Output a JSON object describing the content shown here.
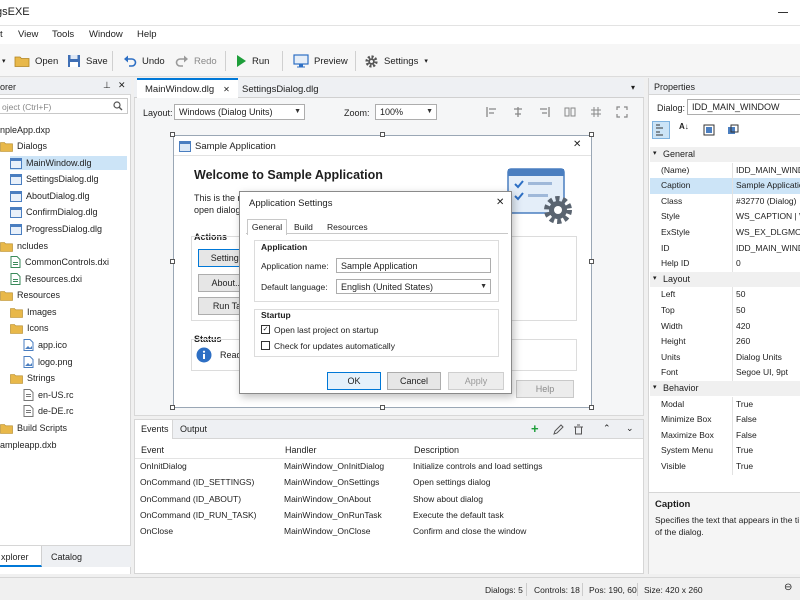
{
  "app": {
    "title": "gsEXE"
  },
  "menu": [
    "t",
    "View",
    "Tools",
    "Window",
    "Help"
  ],
  "toolbar": {
    "open": "Open",
    "save": "Save",
    "undo": "Undo",
    "redo": "Redo",
    "run": "Run",
    "preview": "Preview",
    "settings": "Settings"
  },
  "explorer": {
    "title": "orer",
    "search_placeholder": "oject (Ctrl+F)",
    "items": [
      {
        "label": "npleApp.dxp",
        "icon": "project-icon"
      },
      {
        "label": "Dialogs",
        "icon": "folder-icon"
      },
      {
        "label": "MainWindow.dlg",
        "icon": "dialog-file-icon"
      },
      {
        "label": "SettingsDialog.dlg",
        "icon": "dialog-file-icon"
      },
      {
        "label": "AboutDialog.dlg",
        "icon": "dialog-file-icon"
      },
      {
        "label": "ConfirmDialog.dlg",
        "icon": "dialog-file-icon"
      },
      {
        "label": "ProgressDialog.dlg",
        "icon": "dialog-file-icon"
      },
      {
        "label": "ncludes",
        "icon": "folder-icon"
      },
      {
        "label": "CommonControls.dxi",
        "icon": "include-file-icon"
      },
      {
        "label": "Resources.dxi",
        "icon": "include-file-icon"
      },
      {
        "label": "Resources",
        "icon": "folder-icon"
      },
      {
        "label": "Images",
        "icon": "folder-icon"
      },
      {
        "label": "Icons",
        "icon": "folder-icon"
      },
      {
        "label": "app.ico",
        "icon": "image-file-icon"
      },
      {
        "label": "logo.png",
        "icon": "image-file-icon"
      },
      {
        "label": "Strings",
        "icon": "folder-icon"
      },
      {
        "label": "en-US.rc",
        "icon": "resource-file-icon"
      },
      {
        "label": "de-DE.rc",
        "icon": "resource-file-icon"
      },
      {
        "label": "Build Scripts",
        "icon": "folder-icon"
      },
      {
        "label": "ampleapp.dxb",
        "icon": "build-file-icon"
      }
    ],
    "tabs": [
      "xplorer",
      "Catalog"
    ]
  },
  "editor": {
    "tabs": [
      "MainWindow.dlg",
      "SettingsDialog.dlg"
    ],
    "layout_label": "Layout:",
    "layout_value": "Windows (Dialog Units)",
    "zoom_label": "Zoom:",
    "zoom_value": "100%"
  },
  "sample_dialog": {
    "title": "Sample Application",
    "welcome": "Welcome to Sample Application",
    "intro_line1": "This is the m",
    "intro_line2": "open dialogs",
    "actions_label": "Actions",
    "buttons": [
      "Settings",
      "About...",
      "Run Ta"
    ],
    "status_label": "Status",
    "status_text": "Read",
    "help_button": "Help"
  },
  "settings_dialog": {
    "title": "Application Settings",
    "tabs": [
      "General",
      "Build",
      "Resources"
    ],
    "application_group": "Application",
    "app_name_label": "Application name:",
    "app_name_value": "Sample Application",
    "language_label": "Default language:",
    "language_value": "English (United States)",
    "startup_group": "Startup",
    "check1": "Open last project on startup",
    "check2": "Check for updates automatically",
    "ok": "OK",
    "cancel": "Cancel",
    "apply": "Apply"
  },
  "events_panel": {
    "tabs": [
      "Events",
      "Output"
    ],
    "headers": [
      "Event",
      "Handler",
      "Description"
    ],
    "rows": [
      [
        "OnInitDialog",
        "MainWindow_OnInitDialog",
        "Initialize controls and load settings"
      ],
      [
        "OnCommand (ID_SETTINGS)",
        "MainWindow_OnSettings",
        "Open settings dialog"
      ],
      [
        "OnCommand (ID_ABOUT)",
        "MainWindow_OnAbout",
        "Show about dialog"
      ],
      [
        "OnCommand (ID_RUN_TASK)",
        "MainWindow_OnRunTask",
        "Execute the default task"
      ],
      [
        "OnClose",
        "MainWindow_OnClose",
        "Confirm and close the window"
      ]
    ]
  },
  "properties": {
    "title": "Properties",
    "dialog_label": "Dialog:",
    "dialog_value": "IDD_MAIN_WINDOW",
    "categories": [
      {
        "name": "General",
        "rows": [
          [
            "(Name)",
            "IDD_MAIN_WINDOW"
          ],
          [
            "Caption",
            "Sample Application"
          ],
          [
            "Class",
            "#32770 (Dialog)"
          ],
          [
            "Style",
            "WS_CAPTION | WS_"
          ],
          [
            "ExStyle",
            "WS_EX_DLGMODAL"
          ],
          [
            "ID",
            "IDD_MAIN_WINDOW"
          ],
          [
            "Help ID",
            "0"
          ]
        ]
      },
      {
        "name": "Layout",
        "rows": [
          [
            "Left",
            "50"
          ],
          [
            "Top",
            "50"
          ],
          [
            "Width",
            "420"
          ],
          [
            "Height",
            "260"
          ],
          [
            "Units",
            "Dialog Units"
          ],
          [
            "Font",
            "Segoe UI, 9pt"
          ]
        ]
      },
      {
        "name": "Behavior",
        "rows": [
          [
            "Modal",
            "True"
          ],
          [
            "Minimize Box",
            "False"
          ],
          [
            "Maximize Box",
            "False"
          ],
          [
            "System Menu",
            "True"
          ],
          [
            "Visible",
            "True"
          ]
        ]
      }
    ],
    "caption_title": "Caption",
    "caption_desc_1": "Specifies the text that appears in the ti",
    "caption_desc_2": "of the dialog."
  },
  "status": {
    "dialogs": "Dialogs: 5",
    "controls": "Controls: 18",
    "pos": "Pos: 190, 60",
    "size": "Size: 420 x 260"
  },
  "colors": {
    "accent": "#0078d7",
    "selection": "#cce4f7",
    "green": "#1e9e3a"
  }
}
